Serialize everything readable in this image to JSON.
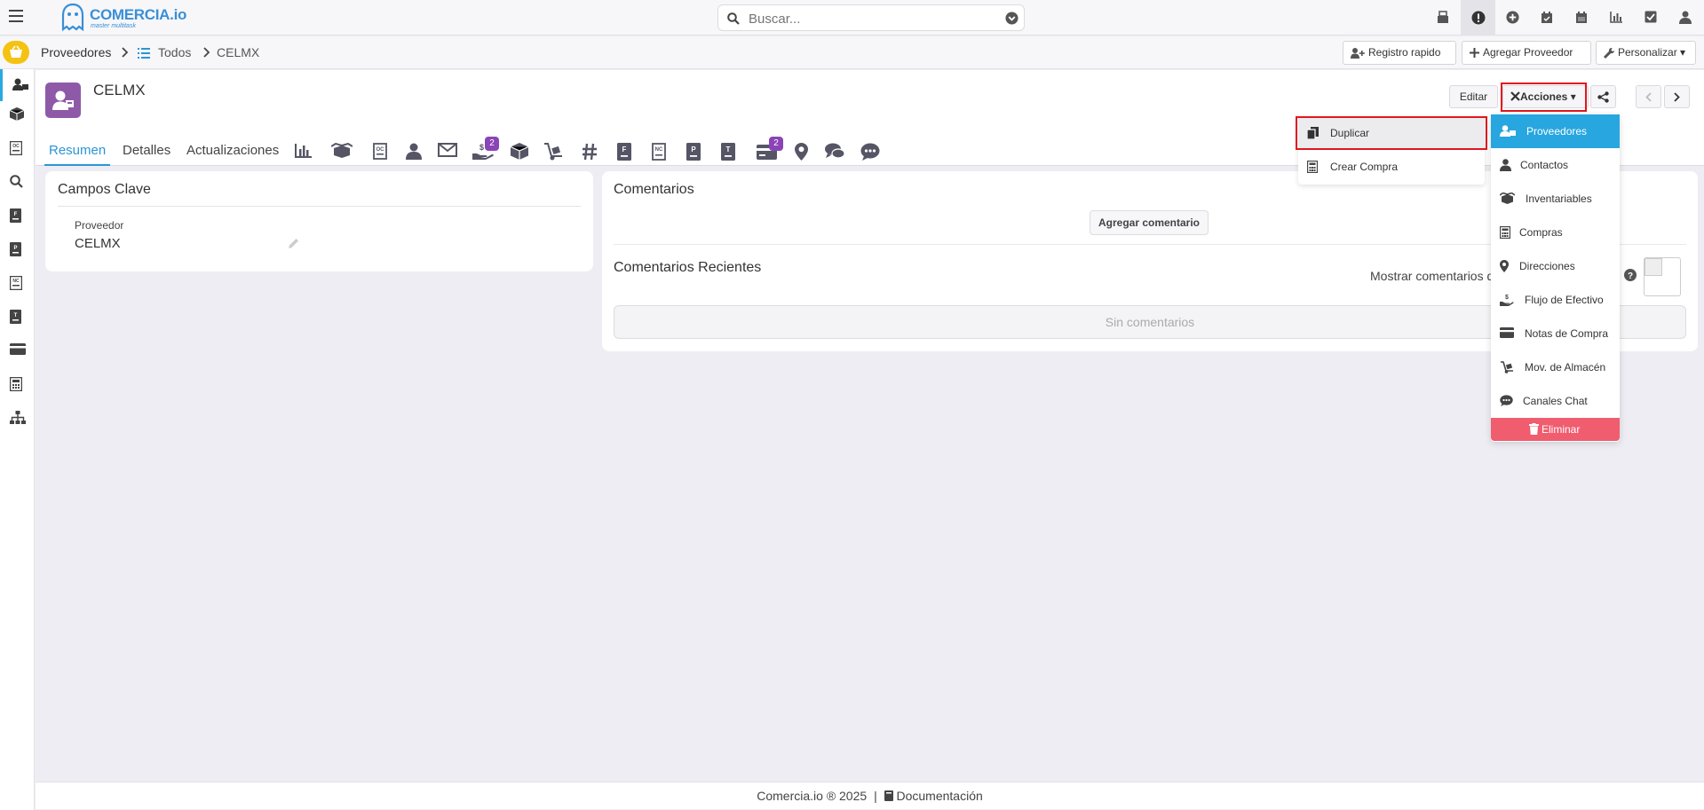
{
  "brand": {
    "name": "COMERCIA.io",
    "tagline": "master multitask"
  },
  "search": {
    "placeholder": "Buscar..."
  },
  "breadcrumb": {
    "section": "Proveedores",
    "list": "Todos",
    "current": "CELMX"
  },
  "crumb_actions": {
    "quick": "Registro rapido",
    "add": "Agregar Proveedor",
    "customize": "Personalizar"
  },
  "record": {
    "title": "CELMX"
  },
  "tabs": {
    "summary": "Resumen",
    "details": "Detalles",
    "updates": "Actualizaciones"
  },
  "tab_badges": {
    "cashflow": "2",
    "notes": "2"
  },
  "header_actions": {
    "edit": "Editar",
    "actions": "Acciones"
  },
  "key_fields": {
    "title": "Campos Clave",
    "field_label": "Proveedor",
    "field_value": "CELMX"
  },
  "comments": {
    "title": "Comentarios",
    "add": "Agregar comentario",
    "recent": "Comentarios Recientes",
    "show": "Mostrar comentarios de",
    "empty": "Sin comentarios"
  },
  "menu_actions": {
    "duplicate": "Duplicar",
    "create_purchase": "Crear Compra"
  },
  "menu_modules": {
    "items": [
      "Proveedores",
      "Contactos",
      "Inventariables",
      "Compras",
      "Direcciones",
      "Flujo de Efectivo",
      "Notas de Compra",
      "Mov. de Almacén",
      "Canales Chat"
    ],
    "delete": "Eliminar"
  },
  "footer": {
    "text": "Comercia.io ® 2025",
    "docs": "Documentación"
  },
  "colors": {
    "accent": "#27a6df",
    "avatar": "#8e5aa8",
    "home": "#f5c211",
    "danger": "#ef5d6f",
    "highlight": "#e0171f",
    "badge": "#8a44b5"
  }
}
